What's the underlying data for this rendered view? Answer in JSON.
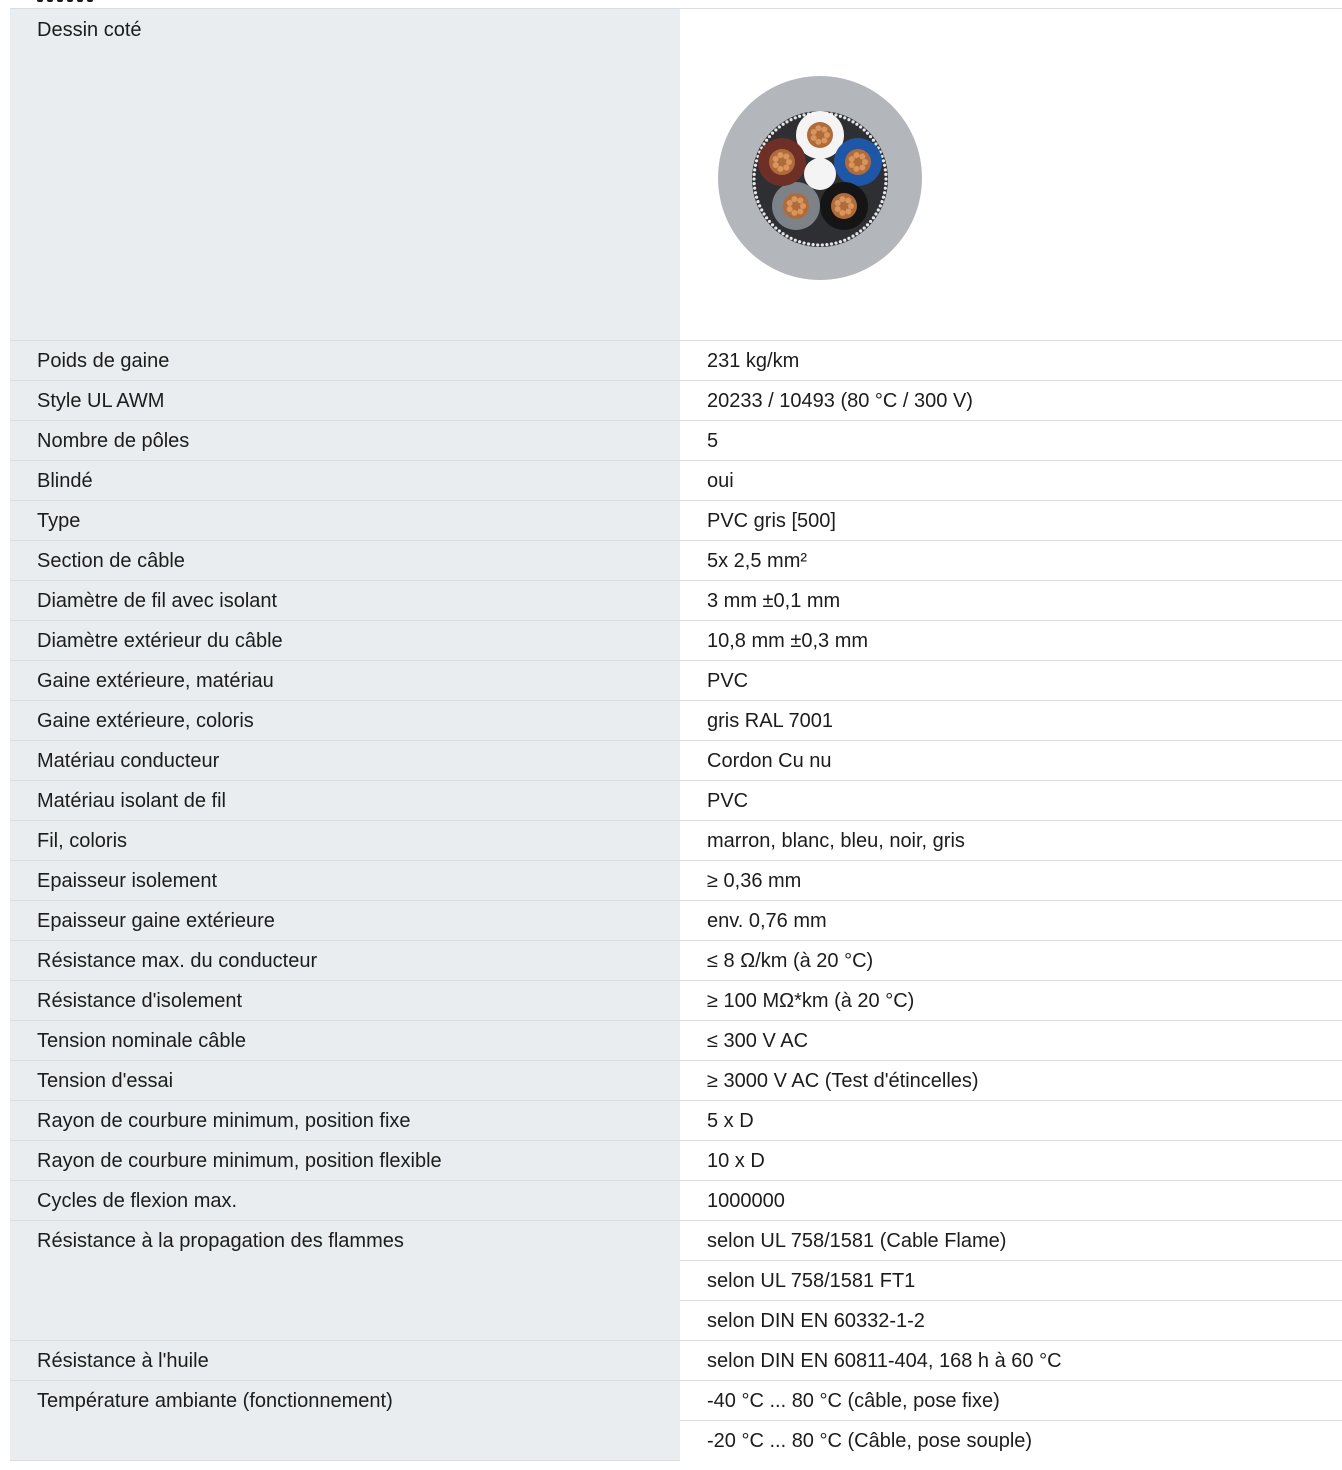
{
  "drawing": {
    "label": "Dessin coté",
    "image_icon": "cable-cross-section-icon",
    "colors": {
      "jacket": "#b3b7bc",
      "core_fill": "#2d2f33",
      "brown": "#6e2f26",
      "white": "#f4f4f4",
      "blue": "#1e56a8",
      "black": "#151515",
      "grey": "#7c8288",
      "copper": "#b06b3a"
    }
  },
  "rows": [
    {
      "label": "Poids de gaine",
      "value": "231 kg/km"
    },
    {
      "label": "Style UL AWM",
      "value": "20233 / 10493 (80 °C / 300 V)"
    },
    {
      "label": "Nombre de pôles",
      "value": "5"
    },
    {
      "label": "Blindé",
      "value": "oui"
    },
    {
      "label": "Type",
      "value": "PVC gris [500]"
    },
    {
      "label": "Section de câble",
      "value": "5x 2,5 mm²"
    },
    {
      "label": "Diamètre de fil avec isolant",
      "value": "3 mm ±0,1 mm"
    },
    {
      "label": "Diamètre extérieur du câble",
      "value": "10,8 mm ±0,3 mm"
    },
    {
      "label": "Gaine extérieure, matériau",
      "value": "PVC"
    },
    {
      "label": "Gaine extérieure, coloris",
      "value": "gris RAL 7001"
    },
    {
      "label": "Matériau conducteur",
      "value": "Cordon Cu nu"
    },
    {
      "label": "Matériau isolant de fil",
      "value": "PVC"
    },
    {
      "label": "Fil, coloris",
      "value": "marron, blanc, bleu, noir, gris"
    },
    {
      "label": "Epaisseur isolement",
      "value": "≥ 0,36 mm"
    },
    {
      "label": "Epaisseur gaine extérieure",
      "value": "env. 0,76 mm"
    },
    {
      "label": "Résistance max. du conducteur",
      "value": "≤ 8 Ω/km (à 20 °C)"
    },
    {
      "label": "Résistance d'isolement",
      "value": "≥ 100 MΩ*km (à 20 °C)"
    },
    {
      "label": "Tension nominale câble",
      "value": "≤ 300 V AC"
    },
    {
      "label": "Tension d'essai",
      "value": "≥ 3000 V AC (Test d'étincelles)"
    },
    {
      "label": "Rayon de courbure minimum, position fixe",
      "value": "5 x D"
    },
    {
      "label": "Rayon de courbure minimum, position flexible",
      "value": "10 x D"
    },
    {
      "label": "Cycles de flexion max.",
      "value": "1000000"
    }
  ],
  "flame": {
    "label": "Résistance à la propagation des flammes",
    "values": [
      "selon UL 758/1581 (Cable Flame)",
      "selon UL 758/1581 FT1",
      "selon DIN EN 60332-1-2"
    ]
  },
  "oil": {
    "label": "Résistance à l'huile",
    "value": "selon DIN EN 60811-404, 168 h à 60 °C"
  },
  "temperature": {
    "label": "Température ambiante (fonctionnement)",
    "values": [
      "-40 °C ... 80 °C (câble, pose fixe)",
      "-20 °C ... 80 °C (Câble, pose souple)"
    ]
  }
}
